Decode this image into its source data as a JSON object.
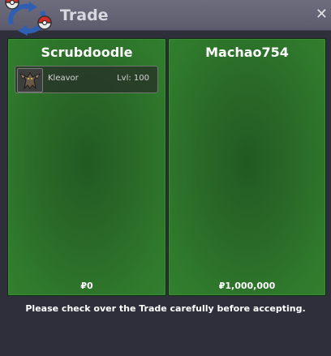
{
  "window": {
    "title": "Trade",
    "close_label": "✕"
  },
  "trade": {
    "left": {
      "player": "Scrubdoodle",
      "pokemon": [
        {
          "name": "Kleavor",
          "level": "Lvl: 100"
        }
      ],
      "money": "₽0"
    },
    "right": {
      "player": "Machao754",
      "pokemon": [],
      "money": "₽1,000,000"
    }
  },
  "notice": "Please check over the Trade carefully before accepting."
}
